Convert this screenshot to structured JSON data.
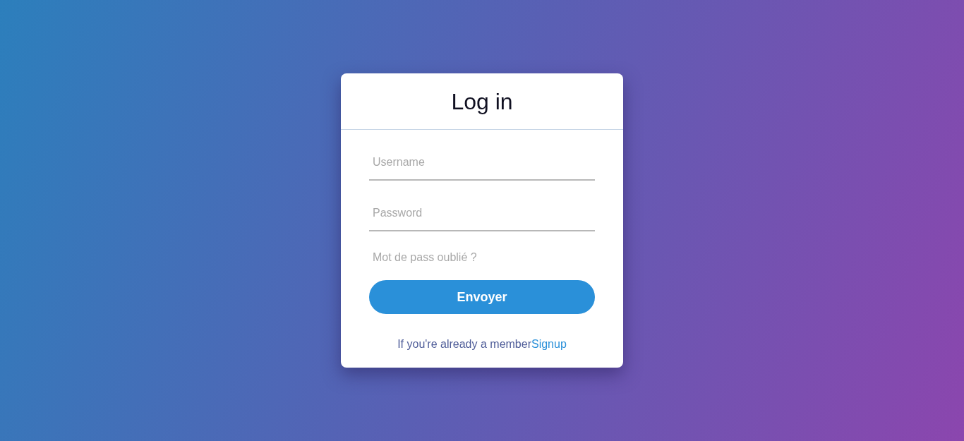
{
  "title": "Log in",
  "fields": [
    {
      "placeholder": "Username"
    },
    {
      "placeholder": "Password"
    }
  ],
  "forgot_link": "Mot de pass oublié ?",
  "submit_button": "Envoyer",
  "footer": {
    "text": "If you're already a member",
    "link": "Signup"
  }
}
